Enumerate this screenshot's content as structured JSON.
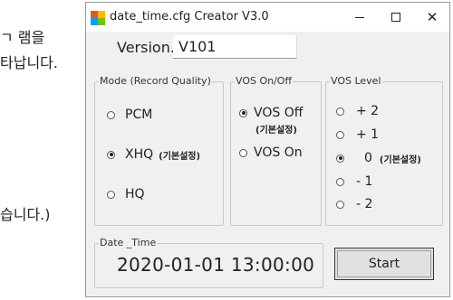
{
  "background_text": {
    "line1": "ㄱ 램을",
    "line2": "타납니다.",
    "line3": "습니다.)"
  },
  "window": {
    "title": "date_time.cfg Creator V3.0",
    "icon_colors": [
      "#f25022",
      "#ffb900",
      "#00a4ef",
      "#7fba00"
    ]
  },
  "version": {
    "label": "Version.",
    "value": "V101"
  },
  "mode": {
    "title": "Mode (Record Quality)",
    "options": [
      {
        "label": "PCM",
        "note": "",
        "checked": false
      },
      {
        "label": "XHQ",
        "note": "(기본설정)",
        "checked": true
      },
      {
        "label": "HQ",
        "note": "",
        "checked": false
      }
    ]
  },
  "vos_onoff": {
    "title": "VOS On/Off",
    "options": [
      {
        "label": "VOS Off",
        "note": "(기본설정)",
        "checked": true
      },
      {
        "label": "VOS On",
        "note": "",
        "checked": false
      }
    ]
  },
  "vos_level": {
    "title": "VOS Level",
    "options": [
      {
        "label": "+ 2",
        "note": "",
        "checked": false
      },
      {
        "label": "+ 1",
        "note": "",
        "checked": false
      },
      {
        "label": "0",
        "note": "(기본설정)",
        "checked": true
      },
      {
        "label": "- 1",
        "note": "",
        "checked": false
      },
      {
        "label": "- 2",
        "note": "",
        "checked": false
      }
    ]
  },
  "date_time": {
    "title": "Date _Time",
    "value": "2020-01-01 13:00:00"
  },
  "start_label": "Start"
}
